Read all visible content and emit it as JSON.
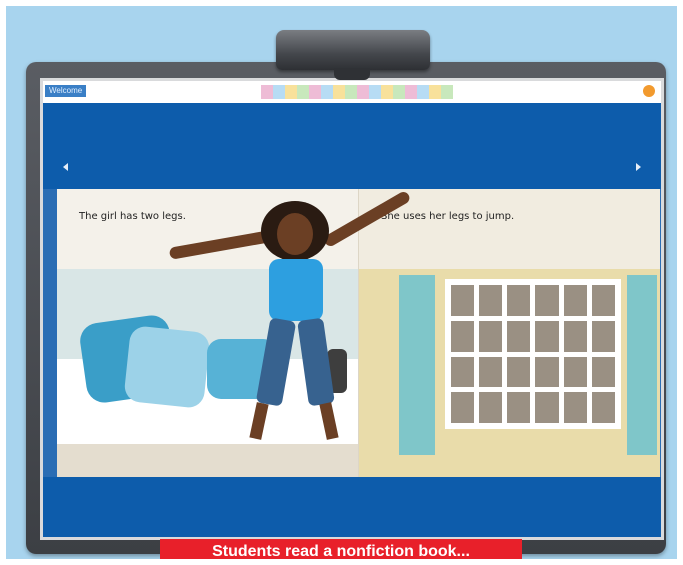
{
  "app": {
    "home_label": "Welcome"
  },
  "book": {
    "left_page_text": "The girl has two legs.",
    "right_page_text": "She uses her legs to jump."
  },
  "caption": {
    "text": "Students read a nonfiction book..."
  },
  "colors": {
    "background": "#a8d4ee",
    "board_frame": "#3c3f44",
    "nav_band": "#0d5cab",
    "caption_bg": "#e8202a",
    "caption_text": "#ffffff"
  },
  "icons": {
    "prev": "chevron-left-icon",
    "next": "chevron-right-icon",
    "sound": "sound-icon"
  }
}
